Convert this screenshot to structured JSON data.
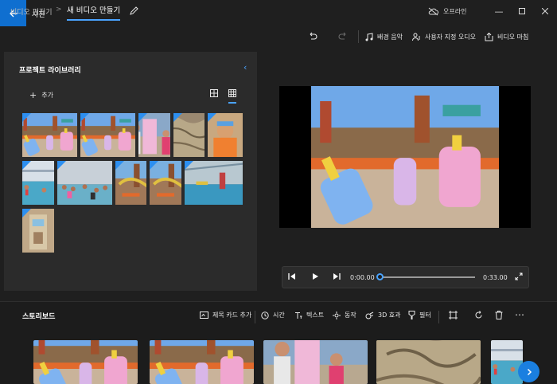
{
  "app": {
    "title": "사진",
    "offline_label": "오프라인"
  },
  "breadcrumb": {
    "parent": "비디오 편집기",
    "separator": ">",
    "current": "새 비디오 만들기"
  },
  "toolbar": {
    "music_label": "배경 음악",
    "custom_audio_label": "사용자 지정 오디오",
    "finish_label": "비디오 마침"
  },
  "library": {
    "title": "프로젝트 라이브러리",
    "add_label": "추가",
    "thumbnails": [
      {
        "scene": "popsicle"
      },
      {
        "scene": "popsicle"
      },
      {
        "scene": "people"
      },
      {
        "scene": "rock"
      },
      {
        "scene": "child"
      },
      {
        "scene": "pool"
      },
      {
        "scene": "crowd"
      },
      {
        "scene": "slides"
      },
      {
        "scene": "slides"
      },
      {
        "scene": "indoor"
      },
      {
        "scene": "tower"
      }
    ]
  },
  "player": {
    "current_time": "0:00.00",
    "total_time": "0:33.00",
    "progress": 0
  },
  "storyboard": {
    "title": "스토리보드",
    "title_card_label": "제목 카드 추가",
    "duration_label": "시간",
    "text_label": "텍스트",
    "motion_label": "동작",
    "effects_3d_label": "3D 효과",
    "filters_label": "필터",
    "clips": [
      {
        "scene": "popsicle"
      },
      {
        "scene": "popsicle"
      },
      {
        "scene": "people"
      },
      {
        "scene": "rock"
      },
      {
        "scene": "pool"
      }
    ]
  },
  "colors": {
    "accent": "#4aa3ff",
    "back_button": "#0f6fd0",
    "panel": "#2b2b2b",
    "background": "#1f1f1f"
  },
  "icons": [
    "back-arrow-icon",
    "cloud-off-icon",
    "minimize-icon",
    "maximize-icon",
    "close-icon",
    "pencil-icon",
    "undo-icon",
    "redo-icon",
    "music-note-icon",
    "user-audio-icon",
    "export-icon",
    "chevron-left-icon",
    "plus-icon",
    "grid-large-icon",
    "grid-small-icon",
    "skip-back-icon",
    "play-icon",
    "skip-forward-icon",
    "fullscreen-icon",
    "title-card-icon",
    "clock-icon",
    "text-icon",
    "motion-icon",
    "3d-effects-icon",
    "filter-icon",
    "crop-icon",
    "rotate-icon",
    "trash-icon",
    "more-icon",
    "chevron-right-icon"
  ]
}
